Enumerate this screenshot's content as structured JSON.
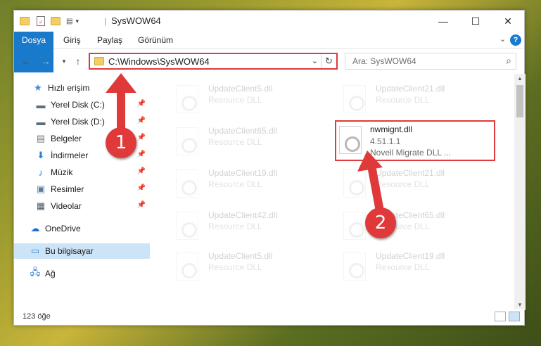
{
  "window": {
    "title": "SysWOW64",
    "controls": {
      "minimize": "—",
      "maximize": "☐",
      "close": "✕"
    }
  },
  "ribbon": {
    "tabs": [
      "Dosya",
      "Giriş",
      "Paylaş",
      "Görünüm"
    ]
  },
  "nav": {
    "address": "C:\\Windows\\SysWOW64",
    "search_placeholder": "Ara: SysWOW64"
  },
  "sidebar": {
    "items": [
      {
        "label": "Hızlı erişim",
        "icon": "star-icon"
      },
      {
        "label": "Yerel Disk (C:)",
        "icon": "drive-icon",
        "pinned": true
      },
      {
        "label": "Yerel Disk (D:)",
        "icon": "drive-icon",
        "pinned": true
      },
      {
        "label": "Belgeler",
        "icon": "documents-icon",
        "pinned": true
      },
      {
        "label": "İndirmeler",
        "icon": "download-icon",
        "pinned": true
      },
      {
        "label": "Müzik",
        "icon": "music-icon",
        "pinned": true
      },
      {
        "label": "Resimler",
        "icon": "pictures-icon",
        "pinned": true
      },
      {
        "label": "Videolar",
        "icon": "videos-icon",
        "pinned": true
      },
      {
        "label": "OneDrive",
        "icon": "cloud-icon"
      },
      {
        "label": "Bu bilgisayar",
        "icon": "computer-icon",
        "selected": true
      },
      {
        "label": "Ağ",
        "icon": "network-icon"
      }
    ]
  },
  "files": {
    "left": [
      {
        "name": "UpdateClient5.dll",
        "desc": "Resource DLL"
      },
      {
        "name": "UpdateClient65.dll",
        "desc": "Resource DLL"
      },
      {
        "name": "UpdateClient19.dll",
        "desc": "Resource DLL"
      },
      {
        "name": "UpdateClient42.dll",
        "desc": "Resource DLL"
      },
      {
        "name": "UpdateClient5.dll",
        "desc": "Resource DLL"
      }
    ],
    "right": [
      {
        "name": "UpdateClient21.dll",
        "desc": "Resource DLL"
      },
      {
        "name": "UpdateClient21.dll",
        "desc": "Resource DLL"
      },
      {
        "name": "UpdateClient65.dll",
        "desc": "Resource DLL"
      },
      {
        "name": "UpdateClient19.dll",
        "desc": "Resource DLL"
      }
    ],
    "highlighted": {
      "name": "nwmignt.dll",
      "version": "4.51.1.1",
      "desc": "Novell Migrate DLL ..."
    }
  },
  "status": {
    "count": "123 öğe"
  },
  "annotations": {
    "step1": "1",
    "step2": "2",
    "color": "#e0393a"
  }
}
